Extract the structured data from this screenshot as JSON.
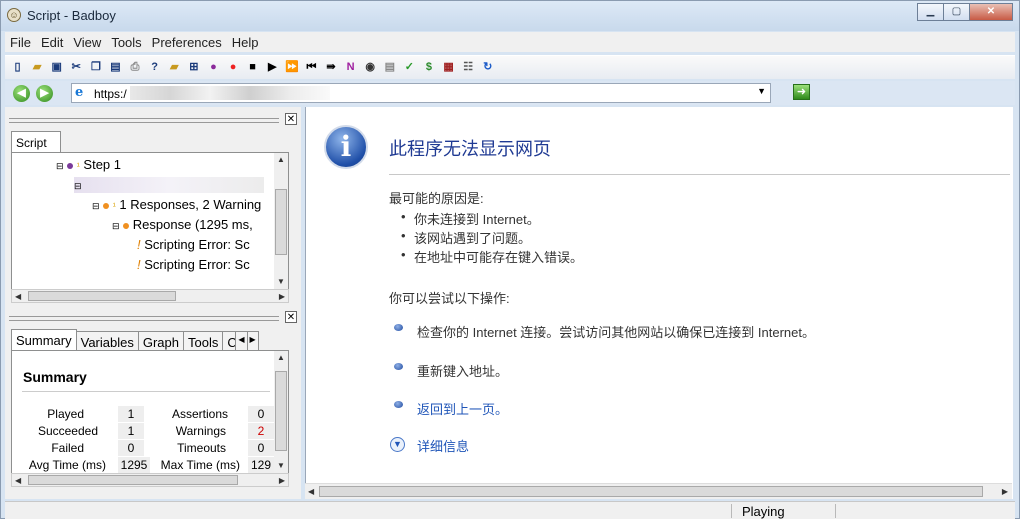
{
  "window": {
    "title": "Script - Badboy"
  },
  "menu": [
    "File",
    "Edit",
    "View",
    "Tools",
    "Preferences",
    "Help"
  ],
  "toolbar": {
    "icons": [
      "new-icon",
      "open-icon",
      "save-icon",
      "cut-icon",
      "copy-icon",
      "paste-icon",
      "print-icon",
      "help-icon",
      "new-folder-icon",
      "add-item-icon",
      "add-step-icon",
      "record-icon",
      "stop-icon",
      "play-icon",
      "fast-forward-icon",
      "rewind-icon",
      "navigate-icon",
      "n-icon",
      "screenshot-icon",
      "page-icon",
      "check-icon",
      "dollar-icon",
      "table-icon",
      "tree-icon",
      "refresh-icon"
    ]
  },
  "address": {
    "value": "https:/"
  },
  "script_tab": {
    "label": "Script"
  },
  "tree": {
    "step": "Step 1",
    "responses": "1 Responses, 2 Warning",
    "response": "Response (1295 ms, ",
    "error1": "Scripting Error: Sc",
    "error2": "Scripting Error: Sc"
  },
  "tabs": [
    "Summary",
    "Variables",
    "Graph",
    "Tools",
    "C"
  ],
  "summary": {
    "title": "Summary",
    "played_label": "Played",
    "played": "1",
    "succeeded_label": "Succeeded",
    "succeeded": "1",
    "failed_label": "Failed",
    "failed": "0",
    "avg_label": "Avg Time (ms)",
    "avg": "1295",
    "assertions_label": "Assertions",
    "assertions": "0",
    "warnings_label": "Warnings",
    "warnings": "2",
    "timeouts_label": "Timeouts",
    "timeouts": "0",
    "max_label": "Max Time (ms)",
    "max": "129"
  },
  "error_page": {
    "title": "此程序无法显示网页",
    "reason_head": "最可能的原因是:",
    "reasons": [
      "你未连接到 Internet。",
      "该网站遇到了问题。",
      "在地址中可能存在键入错误。"
    ],
    "try_head": "你可以尝试以下操作:",
    "suggestions": [
      "检查你的 Internet 连接。尝试访问其他网站以确保已连接到 Internet。",
      "重新键入地址。",
      "返回到上一页。"
    ],
    "more": "详细信息"
  },
  "status": {
    "text": "Playing"
  },
  "colors": {
    "accent": "#1f3a93",
    "link": "#1f55b8",
    "warning": "#cc0000"
  }
}
